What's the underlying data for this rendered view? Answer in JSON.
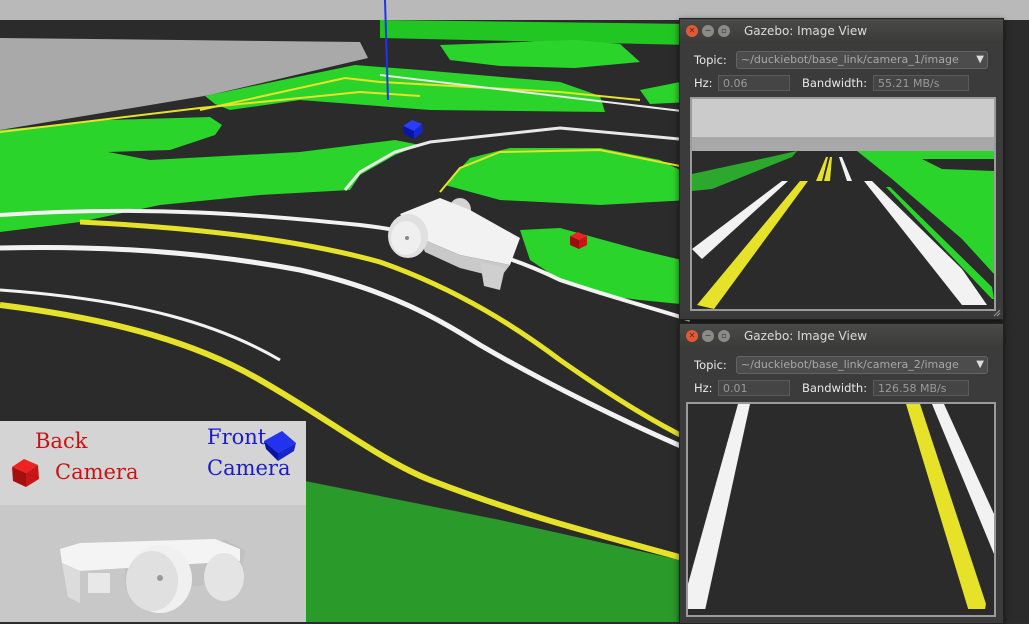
{
  "colors": {
    "grass": "#2bd42b",
    "road": "#2b2b2b",
    "line_white": "#f2f2f2",
    "line_yellow": "#e6e22a",
    "sky": "#c9c9c9",
    "window_bg": "#3b3b3b",
    "back_label": "#cc1111",
    "front_label": "#1a1acc"
  },
  "window1": {
    "title": "Gazebo: Image View",
    "topic_label": "Topic:",
    "topic_value": "~/duckiebot/base_link/camera_1/image",
    "hz_label": "Hz:",
    "hz_value": "0.06",
    "bandwidth_label": "Bandwidth:",
    "bandwidth_value": "55.21 MB/s"
  },
  "window2": {
    "title": "Gazebo: Image View",
    "topic_label": "Topic:",
    "topic_value": "~/duckiebot/base_link/camera_2/image",
    "hz_label": "Hz:",
    "hz_value": "0.01",
    "bandwidth_label": "Bandwidth:",
    "bandwidth_value": "126.58 MB/s"
  },
  "legend": {
    "back_line1": "Back",
    "back_line2": "Camera",
    "front_line1": "Front",
    "front_line2": "Camera"
  },
  "icons": [
    "close-icon",
    "minimize-icon",
    "maximize-icon",
    "chevron-down-icon",
    "resize-grip-icon"
  ]
}
